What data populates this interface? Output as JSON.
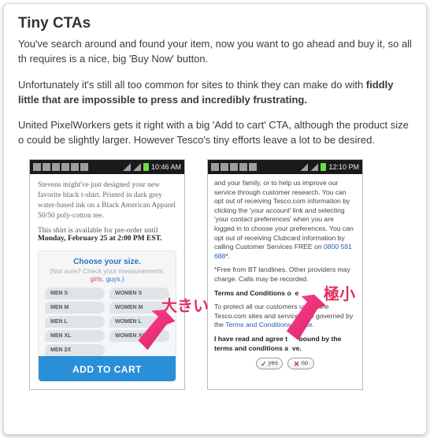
{
  "article": {
    "heading": "Tiny CTAs",
    "p1": "You've search around and found your item, now you want to go ahead and buy it, so all th requires is a nice, big 'Buy Now' button.",
    "p2_a": "Unfortunately it's still all too common for sites to think they can make do with ",
    "p2_b": "fiddly little that are impossible to press and incredibly frustrating.",
    "p3": "United PixelWorkers gets it right with a big 'Add to cart' CTA, although the product size o could be slightly larger. However Tesco's tiny efforts leave a lot to be desired."
  },
  "phone1": {
    "time": "10:46 AM",
    "desc": "Stevens might've just designed your new favorite black t-shirt. Printed in dark grey water-based ink on a Black American Apparel 50/50 poly-cotton tee.",
    "avail_prefix": "This shirt is available for pre-order until",
    "avail_date": "Monday, February 25 at 2:00 PM EST.",
    "choose": "Choose your size.",
    "hint_a": "(Not sure? Check",
    "hint_b": "your measurements:",
    "hint_girls": "girls,",
    "hint_guys": "guys.)",
    "sizes": [
      "MEN S",
      "WOMEN S",
      "MEN M",
      "WOMEN M",
      "MEN L",
      "WOMEN L",
      "MEN XL",
      "WOMEN XL",
      "MEN 2X",
      ""
    ],
    "cta": "ADD TO CART"
  },
  "phone2": {
    "time": "12:10 PM",
    "para1_a": "and your family, or to help us improve our service through customer research. You can opt out of receiving Tesco.com information by clicking the 'your account' link and selecting 'your contact preferences' when you are logged in to choose your preferences. You can opt out of receiving Clubcard information by calling Customer Services FREE on ",
    "phone_num": "0800 591 688",
    "para1_b": "*.",
    "para2": "*Free from BT landlines. Other providers may charge. Calls may be recorded.",
    "terms_label_a": "Terms and Conditions o",
    "terms_label_b": "e",
    "para3_a": "To protect all our customers use of the Tesco.com sites and services are governed by the ",
    "terms_link": "Terms and Conditions of Use",
    "para3_b": ".",
    "agree_a": "I have read and agree t",
    "agree_b": "bound by the terms and conditions a",
    "agree_c": "ve.",
    "yes": "yes",
    "no": "no"
  },
  "annotations": {
    "big": "大きい",
    "tiny": "極小"
  }
}
